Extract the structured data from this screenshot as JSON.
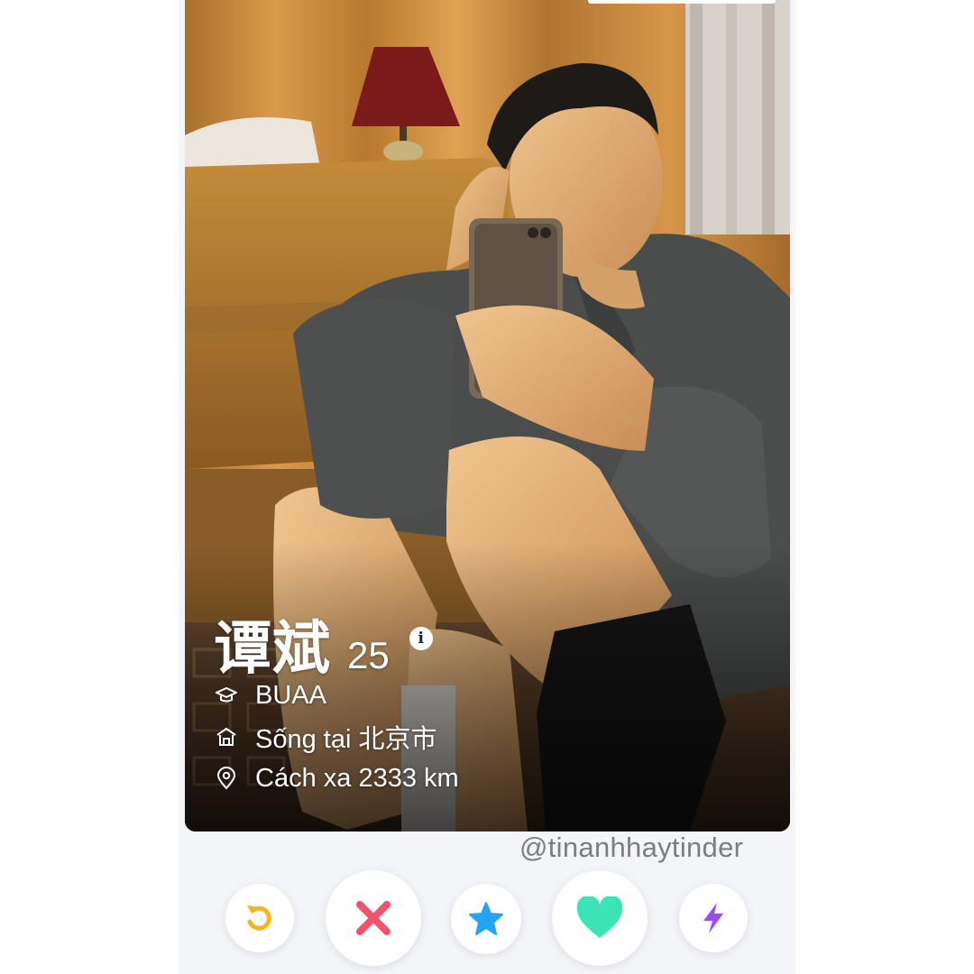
{
  "profile": {
    "name": "谭斌",
    "age": "25",
    "school": "BUAA",
    "lives_in": "Sống tại 北京市",
    "distance": "Cách xa 2333 km"
  },
  "watermark": "@tinanhhaytinder",
  "actions": {
    "rewind": {
      "icon": "rewind-icon",
      "color": "#f3b61f"
    },
    "nope": {
      "icon": "close-icon",
      "color": "#f2526b"
    },
    "super_like": {
      "icon": "star-icon",
      "color": "#24a4f3"
    },
    "like": {
      "icon": "heart-icon",
      "color": "#3ce3b4"
    },
    "boost": {
      "icon": "lightning-icon",
      "color": "#9b4cf0"
    }
  },
  "colors": {
    "background": "#ffffff",
    "app_background": "#f4f5f9",
    "watermark": "#7d7d80"
  }
}
